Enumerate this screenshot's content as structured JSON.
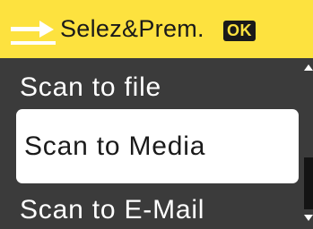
{
  "header": {
    "title": "Selez&Prem.",
    "ok_label": "OK",
    "icon": "scan-icon",
    "background_color": "#fde23f"
  },
  "menu": {
    "items": [
      {
        "label": "Scan to file",
        "selected": false
      },
      {
        "label": "Scan to Media",
        "selected": true
      },
      {
        "label": "Scan to E-Mail",
        "selected": false
      }
    ]
  },
  "scrollbar": {
    "up_icon": "arrow-up-icon",
    "down_icon": "arrow-down-icon"
  }
}
